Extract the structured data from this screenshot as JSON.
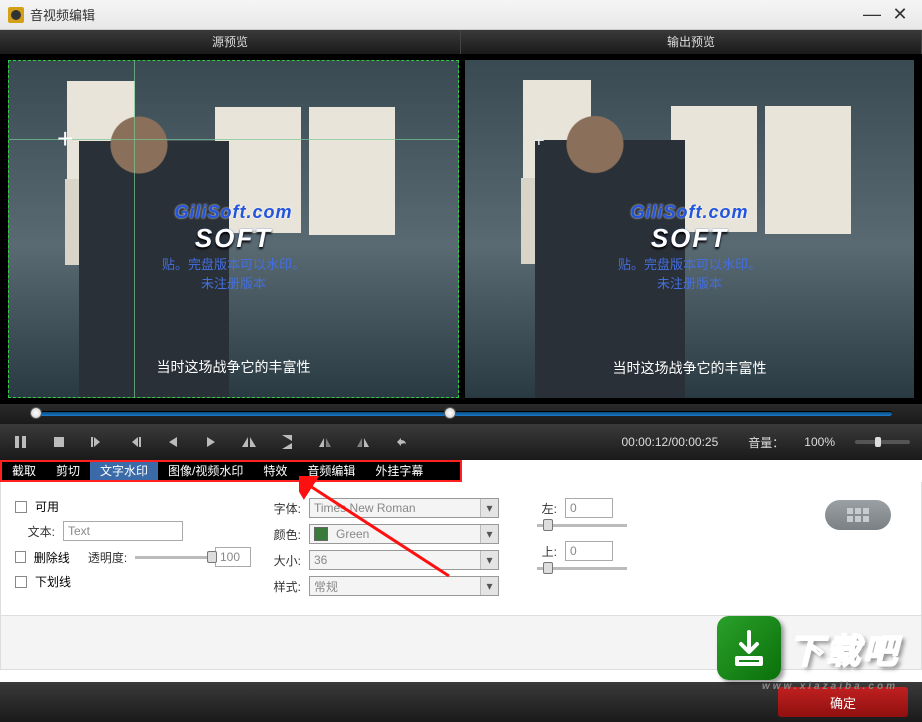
{
  "window": {
    "title": "音视频编辑"
  },
  "previews": {
    "source_label": "源预览",
    "output_label": "输出预览"
  },
  "video": {
    "subtitle": "当时这场战争它的丰富性",
    "watermark_top": "GiliSoft.com",
    "watermark_soft": "SOFT",
    "watermark_line2": "贴。完盘版本可以水印。",
    "watermark_line3": "未注册版本"
  },
  "playback": {
    "time_current": "00:00:12",
    "time_total": "00:00:25",
    "volume_label": "音量：",
    "volume_pct": "100%",
    "seek_pct": 48
  },
  "tabs": [
    "截取",
    "剪切",
    "文字水印",
    "图像/视频水印",
    "特效",
    "音频编辑",
    "外挂字幕"
  ],
  "active_tab_index": 2,
  "panel": {
    "enable_label": "可用",
    "text_label": "文本:",
    "text_value": "Text",
    "strike_label": "删除线",
    "underline_label": "下划线",
    "opacity_label": "透明度:",
    "opacity_value": "100",
    "font_label": "字体:",
    "font_value": "Times New Roman",
    "color_label": "颜色:",
    "color_value": "Green",
    "size_label": "大小:",
    "size_value": "36",
    "style_label": "样式:",
    "style_value": "常规",
    "left_label": "左:",
    "left_value": "0",
    "top_label": "上:",
    "top_value": "0"
  },
  "footer": {
    "ok_label": "确定"
  },
  "badge": {
    "text": "下载吧",
    "url": "www.xiazaiba.com"
  }
}
